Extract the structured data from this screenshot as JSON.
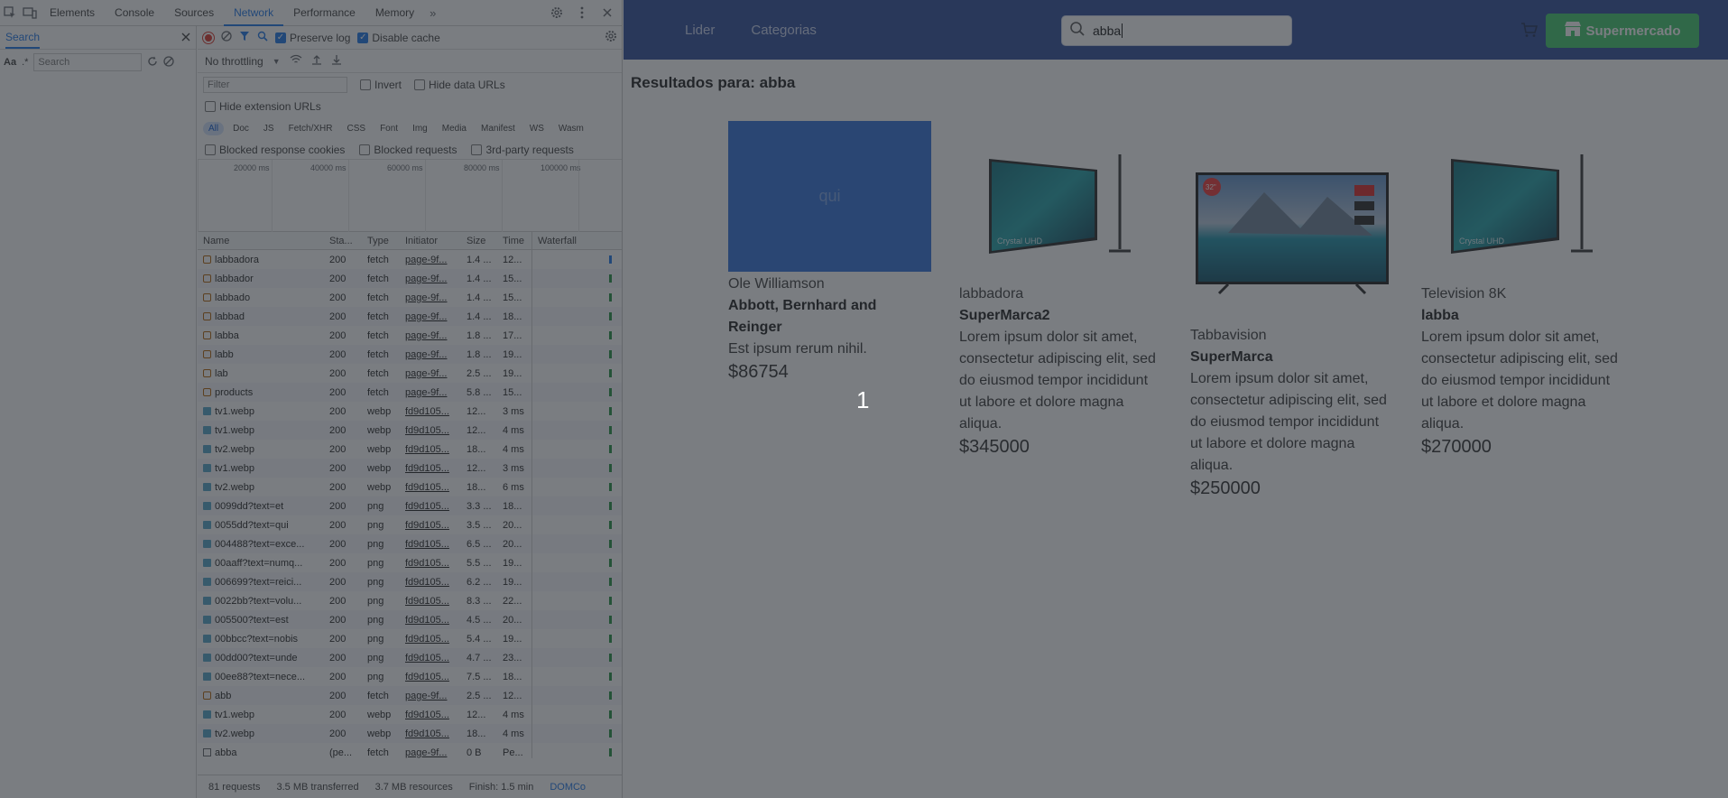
{
  "devtools": {
    "tabs": [
      "Elements",
      "Console",
      "Sources",
      "Network",
      "Performance",
      "Memory"
    ],
    "active_tab": "Network",
    "search": {
      "title": "Search",
      "case_label": "Aa",
      "regex_label": ".*",
      "placeholder": "Search"
    },
    "toolbar": {
      "preserve_log": "Preserve log",
      "disable_cache": "Disable cache",
      "throttling": "No throttling",
      "filter_placeholder": "Filter",
      "invert": "Invert",
      "hide_data_urls": "Hide data URLs",
      "hide_extension_urls": "Hide extension URLs",
      "blocked_cookies": "Blocked response cookies",
      "blocked_requests": "Blocked requests",
      "third_party": "3rd-party requests"
    },
    "type_filters": [
      "All",
      "Doc",
      "JS",
      "Fetch/XHR",
      "CSS",
      "Font",
      "Img",
      "Media",
      "Manifest",
      "WS",
      "Wasm"
    ],
    "timeline_labels": [
      "20000 ms",
      "40000 ms",
      "60000 ms",
      "80000 ms",
      "100000 ms"
    ],
    "columns": [
      "Name",
      "Sta...",
      "Type",
      "Initiator",
      "Size",
      "Time",
      "Waterfall"
    ],
    "rows": [
      {
        "name": "labbadora",
        "status": "200",
        "type": "fetch",
        "initiator": "page-9f...",
        "size": "1.4 ...",
        "time": "12..."
      },
      {
        "name": "labbador",
        "status": "200",
        "type": "fetch",
        "initiator": "page-9f...",
        "size": "1.4 ...",
        "time": "15..."
      },
      {
        "name": "labbado",
        "status": "200",
        "type": "fetch",
        "initiator": "page-9f...",
        "size": "1.4 ...",
        "time": "15..."
      },
      {
        "name": "labbad",
        "status": "200",
        "type": "fetch",
        "initiator": "page-9f...",
        "size": "1.4 ...",
        "time": "18..."
      },
      {
        "name": "labba",
        "status": "200",
        "type": "fetch",
        "initiator": "page-9f...",
        "size": "1.8 ...",
        "time": "17..."
      },
      {
        "name": "labb",
        "status": "200",
        "type": "fetch",
        "initiator": "page-9f...",
        "size": "1.8 ...",
        "time": "19..."
      },
      {
        "name": "lab",
        "status": "200",
        "type": "fetch",
        "initiator": "page-9f...",
        "size": "2.5 ...",
        "time": "19..."
      },
      {
        "name": "products",
        "status": "200",
        "type": "fetch",
        "initiator": "page-9f...",
        "size": "5.8 ...",
        "time": "15..."
      },
      {
        "name": "tv1.webp",
        "status": "200",
        "type": "webp",
        "initiator": "fd9d105...",
        "size": "12...",
        "time": "3 ms"
      },
      {
        "name": "tv1.webp",
        "status": "200",
        "type": "webp",
        "initiator": "fd9d105...",
        "size": "12...",
        "time": "4 ms"
      },
      {
        "name": "tv2.webp",
        "status": "200",
        "type": "webp",
        "initiator": "fd9d105...",
        "size": "18...",
        "time": "4 ms"
      },
      {
        "name": "tv1.webp",
        "status": "200",
        "type": "webp",
        "initiator": "fd9d105...",
        "size": "12...",
        "time": "3 ms"
      },
      {
        "name": "tv2.webp",
        "status": "200",
        "type": "webp",
        "initiator": "fd9d105...",
        "size": "18...",
        "time": "6 ms"
      },
      {
        "name": "0099dd?text=et",
        "status": "200",
        "type": "png",
        "initiator": "fd9d105...",
        "size": "3.3 ...",
        "time": "18..."
      },
      {
        "name": "0055dd?text=qui",
        "status": "200",
        "type": "png",
        "initiator": "fd9d105...",
        "size": "3.5 ...",
        "time": "20..."
      },
      {
        "name": "004488?text=exce...",
        "status": "200",
        "type": "png",
        "initiator": "fd9d105...",
        "size": "6.5 ...",
        "time": "20..."
      },
      {
        "name": "00aaff?text=numq...",
        "status": "200",
        "type": "png",
        "initiator": "fd9d105...",
        "size": "5.5 ...",
        "time": "19..."
      },
      {
        "name": "006699?text=reici...",
        "status": "200",
        "type": "png",
        "initiator": "fd9d105...",
        "size": "6.2 ...",
        "time": "19..."
      },
      {
        "name": "0022bb?text=volu...",
        "status": "200",
        "type": "png",
        "initiator": "fd9d105...",
        "size": "8.3 ...",
        "time": "22..."
      },
      {
        "name": "005500?text=est",
        "status": "200",
        "type": "png",
        "initiator": "fd9d105...",
        "size": "4.5 ...",
        "time": "20..."
      },
      {
        "name": "00bbcc?text=nobis",
        "status": "200",
        "type": "png",
        "initiator": "fd9d105...",
        "size": "5.4 ...",
        "time": "19..."
      },
      {
        "name": "00dd00?text=unde",
        "status": "200",
        "type": "png",
        "initiator": "fd9d105...",
        "size": "4.7 ...",
        "time": "23..."
      },
      {
        "name": "00ee88?text=nece...",
        "status": "200",
        "type": "png",
        "initiator": "fd9d105...",
        "size": "7.5 ...",
        "time": "18..."
      },
      {
        "name": "abb",
        "status": "200",
        "type": "fetch",
        "initiator": "page-9f...",
        "size": "2.5 ...",
        "time": "12..."
      },
      {
        "name": "tv1.webp",
        "status": "200",
        "type": "webp",
        "initiator": "fd9d105...",
        "size": "12...",
        "time": "4 ms"
      },
      {
        "name": "tv2.webp",
        "status": "200",
        "type": "webp",
        "initiator": "fd9d105...",
        "size": "18...",
        "time": "4 ms"
      },
      {
        "name": "abba",
        "status": "(pe...",
        "type": "fetch",
        "initiator": "page-9f...",
        "size": "0 B",
        "time": "Pe..."
      }
    ],
    "status_bar": {
      "requests": "81 requests",
      "transferred": "3.5 MB transferred",
      "resources": "3.7 MB resources",
      "finish": "Finish: 1.5 min",
      "dom": "DOMCo"
    }
  },
  "site": {
    "nav": {
      "home": "Lider",
      "categories": "Categorias"
    },
    "search_value": "abba",
    "brand_button": "Supermercado",
    "results_title": "Resultados para: abba",
    "products": [
      {
        "image_text": "qui",
        "name": "Ole Williamson",
        "brand": "Abbott, Bernhard and Reinger",
        "description": "Est ipsum rerum nihil.",
        "price": "$86754"
      },
      {
        "name": "labbadora",
        "brand": "SuperMarca2",
        "description": "Lorem ipsum dolor sit amet, consectetur adipiscing elit, sed do eiusmod tempor incididunt ut labore et dolore magna aliqua.",
        "price": "$345000"
      },
      {
        "name": "Tabbavision",
        "brand": "SuperMarca",
        "description": "Lorem ipsum dolor sit amet, consectetur adipiscing elit, sed do eiusmod tempor incididunt ut labore et dolore magna aliqua.",
        "price": "$250000"
      },
      {
        "name": "Television 8K",
        "brand": "labba",
        "description": "Lorem ipsum dolor sit amet, consectetur adipiscing elit, sed do eiusmod tempor incididunt ut labore et dolore magna aliqua.",
        "price": "$270000"
      }
    ],
    "tv_badge": "32\"",
    "tv_caption": "Crystal UHD",
    "page_number": "1"
  },
  "colors": {
    "nav_bg": "#2a4a9a",
    "brand_green": "#3ec96a",
    "devtools_accent": "#1a73e8",
    "placeholder_image": "#2f6fd9"
  }
}
